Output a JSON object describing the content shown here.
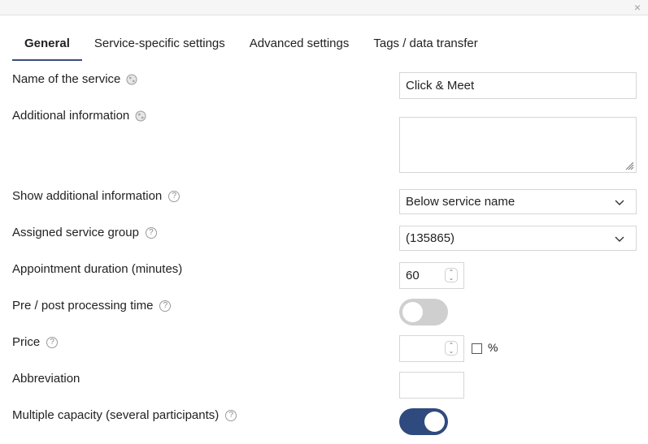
{
  "window": {
    "close_symbol": "×"
  },
  "tabs": [
    {
      "label": "General",
      "active": true
    },
    {
      "label": "Service-specific settings",
      "active": false
    },
    {
      "label": "Advanced settings",
      "active": false
    },
    {
      "label": "Tags / data transfer",
      "active": false
    }
  ],
  "form": {
    "service_name": {
      "label": "Name of the service",
      "value": "Click & Meet"
    },
    "additional_info": {
      "label": "Additional information",
      "value": ""
    },
    "show_additional_info": {
      "label": "Show additional information",
      "selected": "Below service name"
    },
    "service_group": {
      "label": "Assigned service group",
      "selected": "(135865)"
    },
    "duration": {
      "label": "Appointment duration (minutes)",
      "value": "60"
    },
    "processing_time": {
      "label": "Pre / post processing time",
      "enabled": false
    },
    "price": {
      "label": "Price",
      "value": "",
      "percent_label": "%"
    },
    "abbreviation": {
      "label": "Abbreviation",
      "value": ""
    },
    "multiple_capacity": {
      "label": "Multiple capacity (several participants)",
      "enabled": true
    }
  },
  "icons": {
    "help": "?",
    "spin_up": "⌃",
    "spin_down": "⌄"
  },
  "colors": {
    "accent": "#2f4a7e",
    "toggle_off": "#cfcfcf",
    "border": "#d6d6d6"
  }
}
